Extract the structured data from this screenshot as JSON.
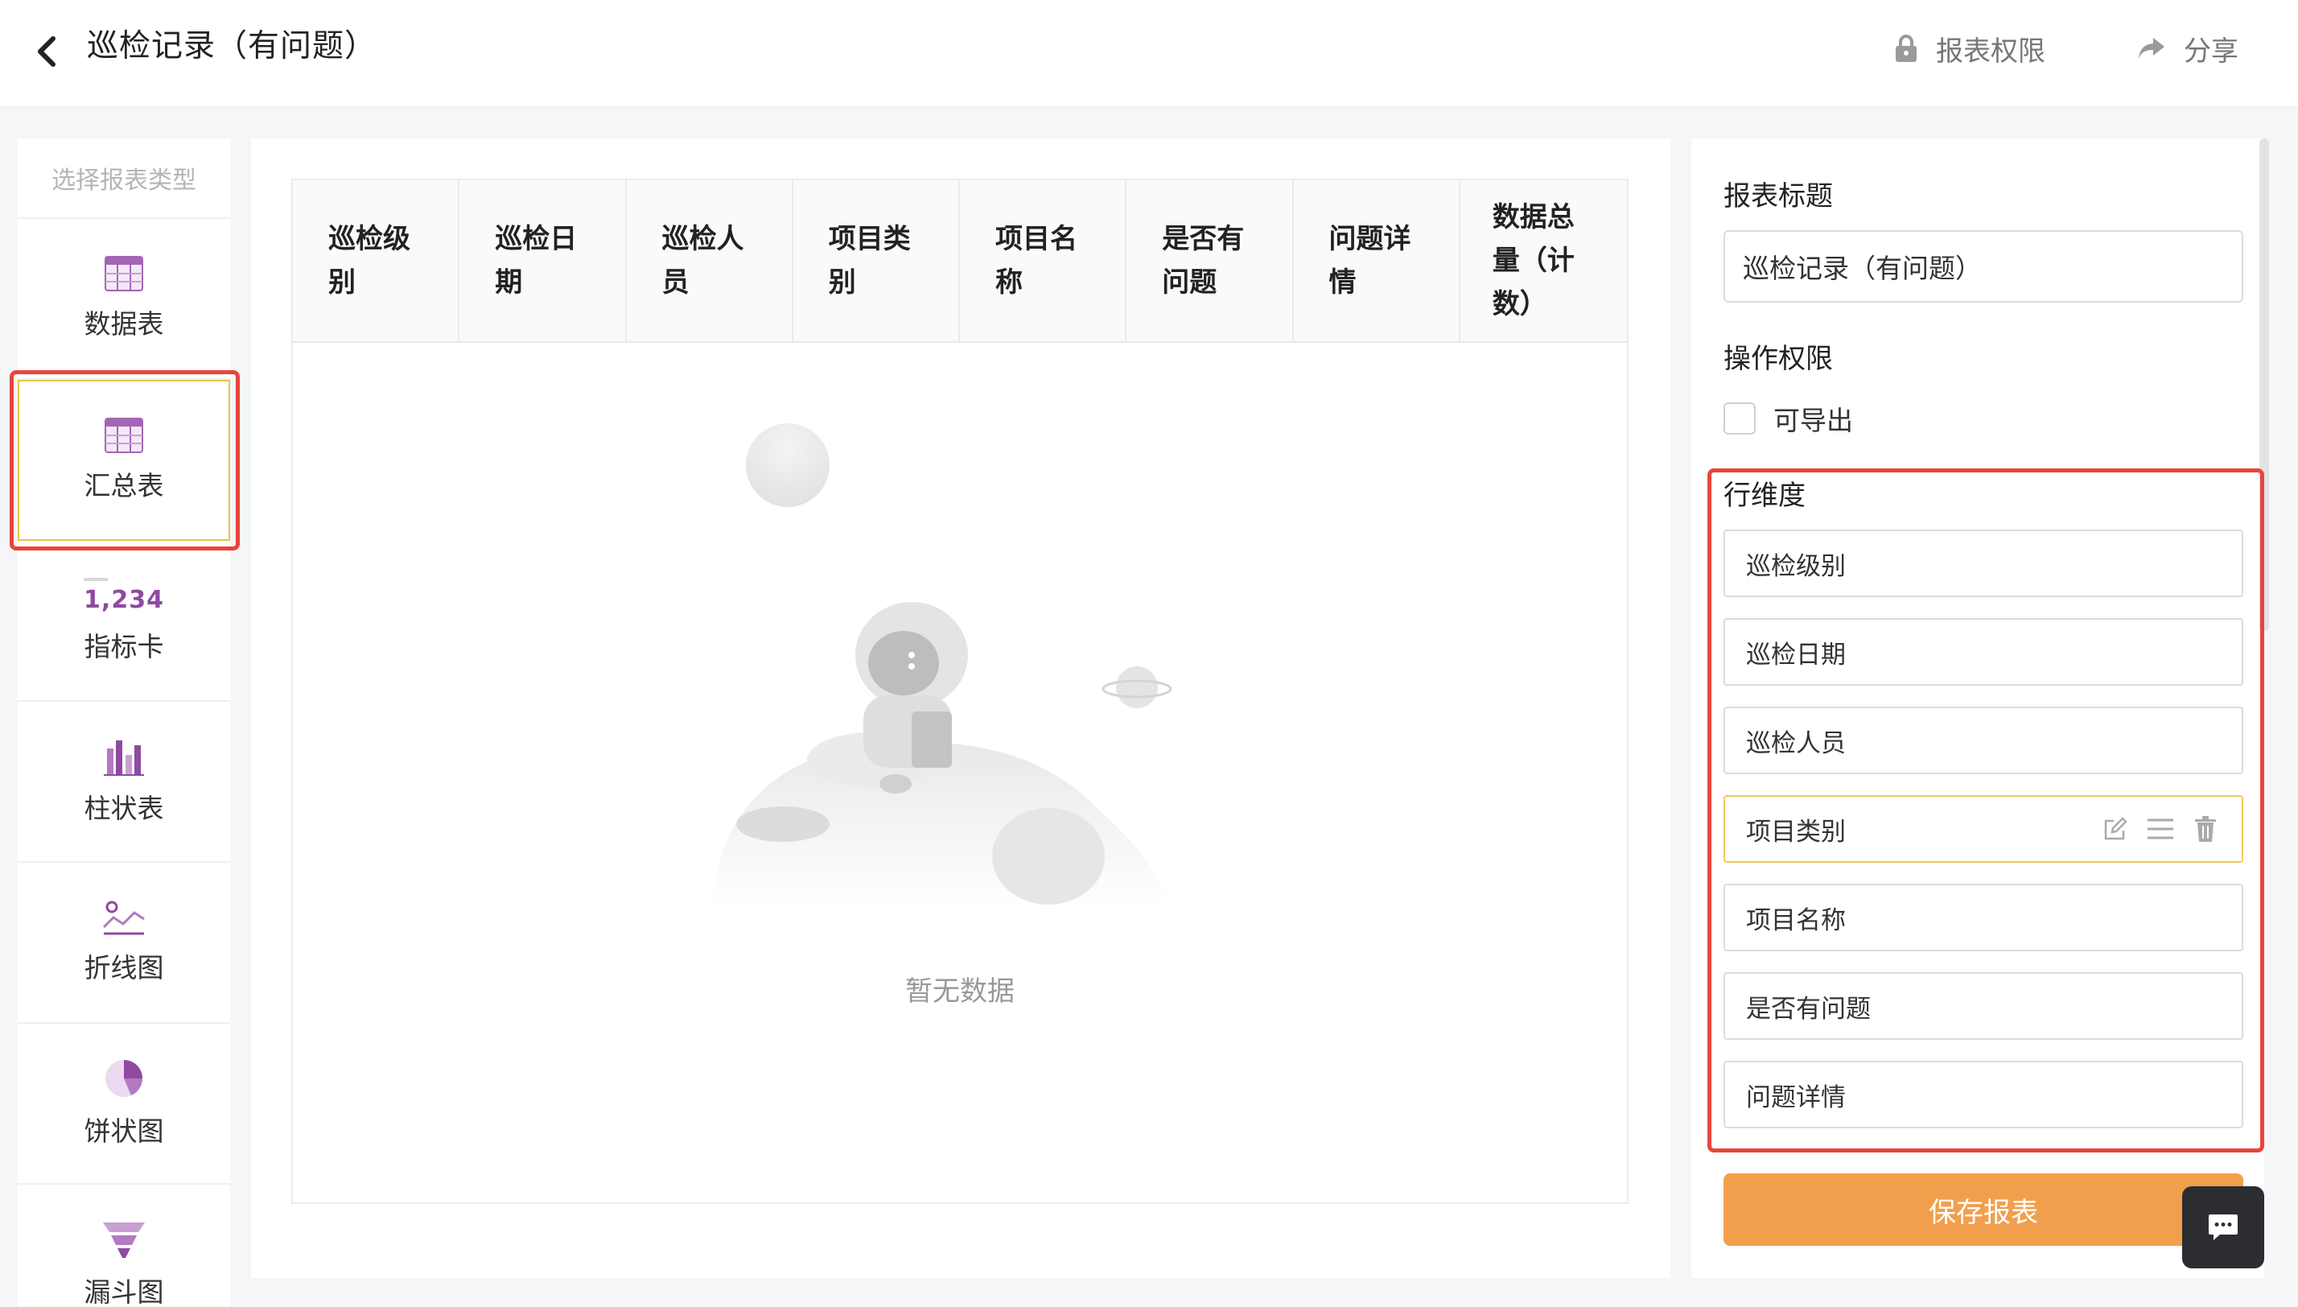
{
  "header": {
    "title": "巡检记录（有问题）",
    "permission_label": "报表权限",
    "share_label": "分享"
  },
  "report_types": {
    "title": "选择报表类型",
    "selected": "汇总表",
    "items": [
      {
        "label": "数据表",
        "icon": "table-icon"
      },
      {
        "label": "汇总表",
        "icon": "summary-table-icon"
      },
      {
        "label": "指标卡",
        "icon": "metric-card-icon",
        "icon_text": "1,234"
      },
      {
        "label": "柱状表",
        "icon": "bar-chart-icon"
      },
      {
        "label": "折线图",
        "icon": "line-chart-icon"
      },
      {
        "label": "饼状图",
        "icon": "pie-chart-icon"
      },
      {
        "label": "漏斗图",
        "icon": "funnel-chart-icon"
      }
    ]
  },
  "table": {
    "columns": [
      "巡检级别",
      "巡检日期",
      "巡检人员",
      "项目类别",
      "项目名称",
      "是否有问题",
      "问题详情",
      "数据总量（计数）"
    ],
    "empty_text": "暂无数据"
  },
  "config": {
    "title_label": "报表标题",
    "title_value": "巡检记录（有问题）",
    "operation_label": "操作权限",
    "export_label": "可导出",
    "export_checked": false,
    "row_dims_label": "行维度",
    "row_dims": [
      "巡检级别",
      "巡检日期",
      "巡检人员",
      "项目类别",
      "项目名称",
      "是否有问题",
      "问题详情"
    ],
    "active_dim": "项目类别",
    "save_label": "保存报表"
  },
  "colors": {
    "accent_orange": "#f29f4d",
    "highlight_red": "#e8453c",
    "purple_icon": "#8e4aa0",
    "active_border": "#f0c95a"
  }
}
